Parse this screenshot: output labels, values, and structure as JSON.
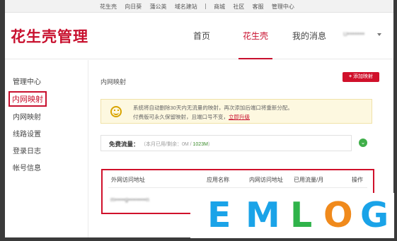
{
  "top_links": [
    "花生壳",
    "向日葵",
    "蒲公英",
    "域名建站",
    "商城",
    "社区",
    "客服",
    "管理中心"
  ],
  "logo_text": "花生壳管理",
  "nav": {
    "home": "首页",
    "peanut": "花生壳",
    "messages": "我的消息",
    "user": "u•••••••"
  },
  "sidebar": {
    "title": "管理中心",
    "items": [
      "内网映射",
      "内网映射",
      "线路设置",
      "登录日志",
      "帐号信息"
    ]
  },
  "main": {
    "title": "内网映射",
    "add_button": "添加映射",
    "notice": {
      "line1": "系统将自动删除30天内无流量的映射，再次添加后端口将重新分配。",
      "line2": "付费版可永久保留映射，且端口号不变，",
      "link": "立即升级"
    },
    "traffic": {
      "label": "免费流量：",
      "prefix": "（本月已用/剩余：0M / ",
      "remaining": "1023M",
      "suffix": "）"
    },
    "table": {
      "headers": [
        "外网访问地址",
        "应用名称",
        "内网访问地址",
        "已用流量/月",
        "操作"
      ],
      "row_address": "m•••••g•••••••••n"
    }
  },
  "watermark": {
    "letters": [
      "E",
      "M",
      "L",
      "O",
      "G"
    ],
    "colors": [
      "#1aa3e8",
      "#1aa3e8",
      "#2fb34a",
      "#f08a1c",
      "#1aa3e8"
    ]
  },
  "colors": {
    "brand": "#c8102e",
    "success": "#3fae49"
  }
}
